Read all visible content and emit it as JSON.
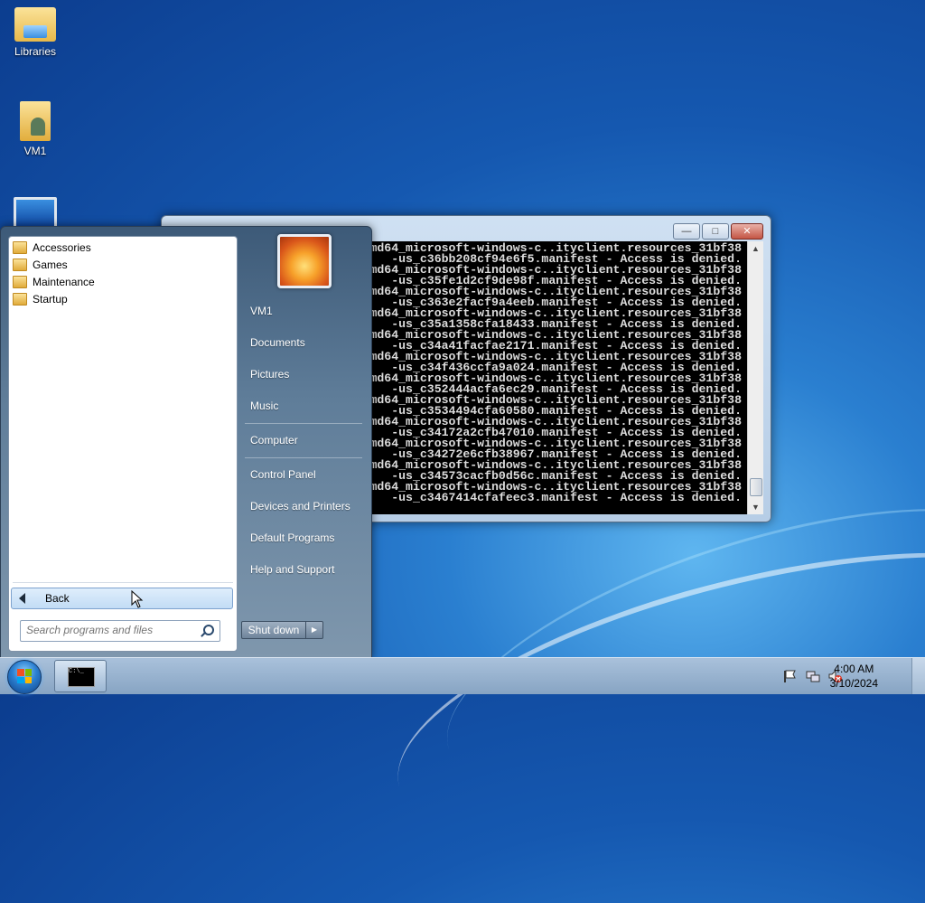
{
  "desktop": {
    "icons": [
      {
        "label": "Libraries",
        "icon": "libraries-icon"
      },
      {
        "label": "VM1",
        "icon": "user-folder-icon"
      },
      {
        "label": "",
        "icon": "computer-icon"
      }
    ]
  },
  "console": {
    "title": "",
    "lines": [
      "md64_microsoft-windows-c..ityclient.resources_31bf38",
      "-us_c36bb208cf94e6f5.manifest - Access is denied.",
      "md64_microsoft-windows-c..ityclient.resources_31bf38",
      "-us_c35fe1d2cf9de98f.manifest - Access is denied.",
      "md64_microsoft-windows-c..ityclient.resources_31bf38",
      "-us_c363e2facf9a4eeb.manifest - Access is denied.",
      "md64_microsoft-windows-c..ityclient.resources_31bf38",
      "-us_c35a1358cfa18433.manifest - Access is denied.",
      "md64_microsoft-windows-c..ityclient.resources_31bf38",
      "-us_c34a41facfae2171.manifest - Access is denied.",
      "md64_microsoft-windows-c..ityclient.resources_31bf38",
      "-us_c34f436ccfa9a024.manifest - Access is denied.",
      "md64_microsoft-windows-c..ityclient.resources_31bf38",
      "-us_c352444acfa6ec29.manifest - Access is denied.",
      "md64_microsoft-windows-c..ityclient.resources_31bf38",
      "-us_c3534494cfa60580.manifest - Access is denied.",
      "md64_microsoft-windows-c..ityclient.resources_31bf38",
      "-us_c34172a2cfb47010.manifest - Access is denied.",
      "md64_microsoft-windows-c..ityclient.resources_31bf38",
      "-us_c34272e6cfb38967.manifest - Access is denied.",
      "md64_microsoft-windows-c..ityclient.resources_31bf38",
      "-us_c34573cacfb0d56c.manifest - Access is denied.",
      "md64_microsoft-windows-c..ityclient.resources_31bf38",
      "-us_c3467414cfafeec3.manifest - Access is denied."
    ]
  },
  "start_menu": {
    "programs": [
      {
        "label": "Accessories",
        "icon": "folder-icon"
      },
      {
        "label": "Games",
        "icon": "folder-icon"
      },
      {
        "label": "Maintenance",
        "icon": "folder-icon"
      },
      {
        "label": "Startup",
        "icon": "folder-icon"
      }
    ],
    "back_label": "Back",
    "search_placeholder": "Search programs and files",
    "right_items": [
      {
        "label": "VM1"
      },
      {
        "label": "Documents"
      },
      {
        "label": "Pictures"
      },
      {
        "label": "Music"
      },
      {
        "label": "Computer"
      },
      {
        "label": "Control Panel"
      },
      {
        "label": "Devices and Printers"
      },
      {
        "label": "Default Programs"
      },
      {
        "label": "Help and Support"
      }
    ],
    "shutdown_label": "Shut down"
  },
  "taskbar": {
    "time": "4:00 AM",
    "date": "3/10/2024",
    "tray_icons": [
      "action-center-flag-icon",
      "network-icon",
      "volume-muted-icon"
    ]
  },
  "colors": {
    "desktop_blue": "#1558b0",
    "console_bg": "#000000",
    "console_text": "#dcdcdc"
  }
}
